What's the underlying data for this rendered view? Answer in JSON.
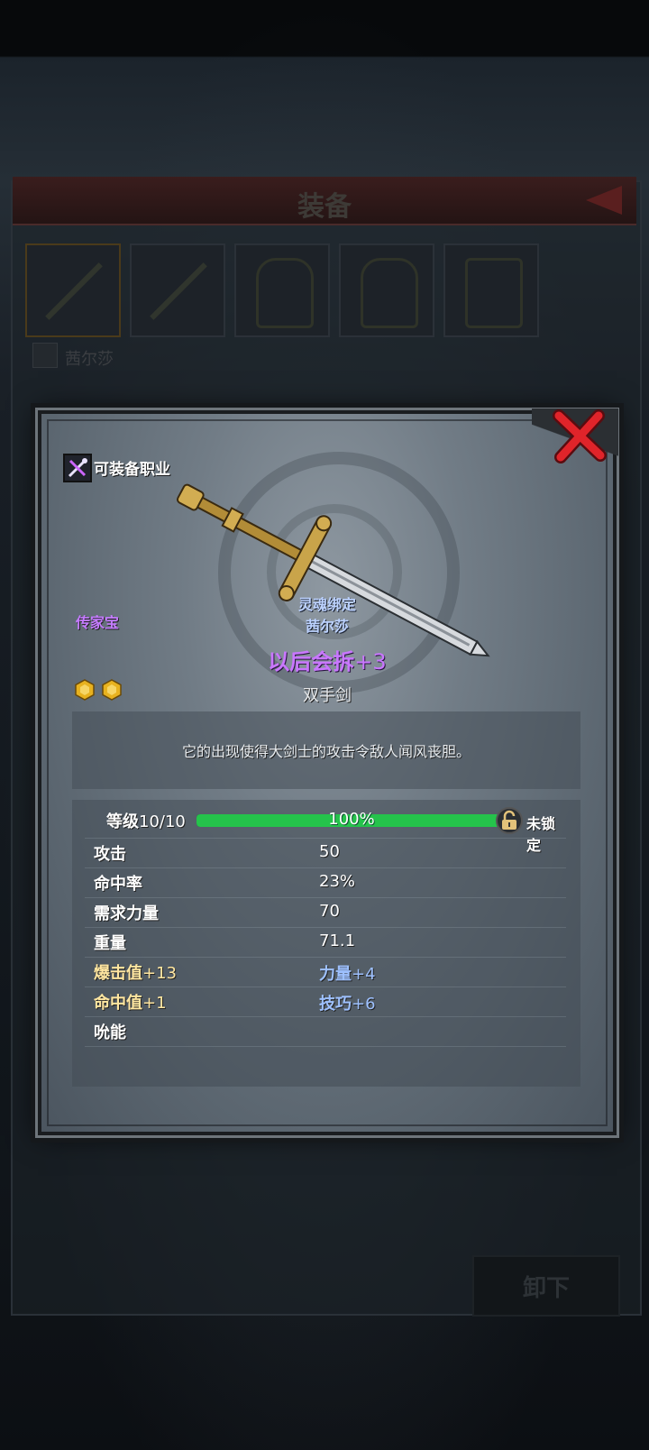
{
  "background": {
    "title": "装备",
    "character_name": "茜尔莎",
    "unequip_label": "卸下"
  },
  "item": {
    "class_label": "可装备职业",
    "rarity": "传家宝",
    "soulbound": "灵魂绑定",
    "bound_to": "茜尔莎",
    "name": "以后会拆",
    "enhance": "+3",
    "type": "双手剑",
    "description": "它的出现使得大剑士的攻击令敌人闻风丧胆。",
    "gems": [
      "gold-gem-icon",
      "gold-gem-icon"
    ]
  },
  "stats": {
    "level_label": "等级",
    "level_value": "10/10",
    "progress_text": "100%",
    "progress_fraction": 1.0,
    "lock_label": "未锁定",
    "rows": [
      {
        "label": "攻击",
        "value": "50"
      },
      {
        "label": "命中率",
        "value": "23%"
      },
      {
        "label": "需求力量",
        "value": "70"
      },
      {
        "label": "重量",
        "value": "71.1"
      }
    ],
    "bonuses": [
      {
        "left": "爆击值",
        "left_val": "+13",
        "right": "力量",
        "right_val": "+4"
      },
      {
        "left": "命中值",
        "left_val": "+1",
        "right": "技巧",
        "right_val": "+6"
      }
    ],
    "skill_label": "吮能"
  },
  "colors": {
    "rarity": "#c977ff",
    "bound": "#bcd2ff",
    "progress": "#25c34b",
    "close": "#e0242a"
  }
}
